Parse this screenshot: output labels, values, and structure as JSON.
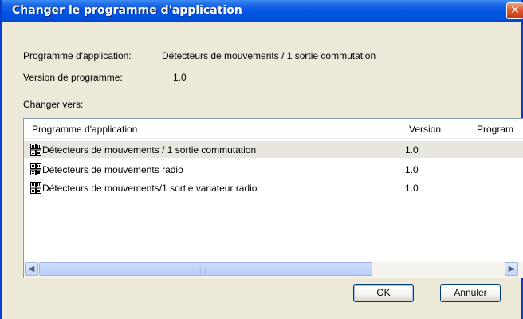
{
  "dialog": {
    "title": "Changer le programme d'application",
    "close_glyph": "✕"
  },
  "info": {
    "program_label": "Programme d'application:",
    "program_value": "Détecteurs de mouvements / 1 sortie commutation",
    "version_label": "Version de programme:",
    "version_value": "1.0"
  },
  "change_to_label": "Changer vers:",
  "list": {
    "columns": [
      "Programme d'application",
      "Version",
      "Program"
    ],
    "rows": [
      {
        "name": "Détecteurs de mouvements / 1 sortie commutation",
        "version": "1.0",
        "selected": true
      },
      {
        "name": "Détecteurs de mouvements radio",
        "version": "1.0",
        "selected": false
      },
      {
        "name": "Détecteurs de mouvements/1 sortie variateur radio",
        "version": "1.0",
        "selected": false
      }
    ],
    "row_icon": "application-program-icon"
  },
  "scrollbar": {
    "left_glyph": "◀",
    "right_glyph": "▶",
    "grip_glyph": "|||"
  },
  "buttons": {
    "ok": "OK",
    "cancel": "Annuler"
  }
}
